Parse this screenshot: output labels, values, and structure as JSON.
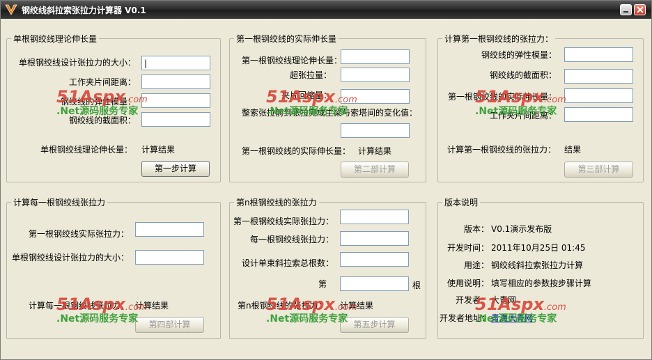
{
  "window": {
    "title": "钢绞线斜拉索张拉力计算器 V0.1"
  },
  "watermark": {
    "brand": "51Aspx",
    "domain": ".com",
    "slogan": ".Net源码服务专家"
  },
  "panel1": {
    "legend": "单根钢绞线理论伸长量",
    "labels": [
      "单根钢绞线设计张拉力的大小：",
      "工作夹片间距离：",
      "钢绞线的弹性模量：",
      "钢绞线的截面积："
    ],
    "input0_value": "|",
    "result_label": "单根钢绞线理论伸长量：",
    "result_value": "计算结果",
    "button": "第一步计算"
  },
  "panel2": {
    "legend": "第一根钢绞线的实际伸长量",
    "labels": [
      "第一根钢绞线理论伸长量：",
      "超张拉量：",
      "夹片回缩量：",
      "整索张拉前到张拉完成主梁与索塔间的变化值："
    ],
    "result_label": "第一根钢绞线的实际伸长量：",
    "result_value": "计算结果",
    "button": "第二部计算"
  },
  "panel3": {
    "legend": "计算第一根钢绞线的张拉力：",
    "labels": [
      "钢绞线的弹性模量：",
      "钢绞线的截面积：",
      "第一根钢绞线的实际伸长量：",
      "工作夹片间距离："
    ],
    "result_label": "计算第一根钢绞线的张拉力：",
    "result_value": "结果",
    "button": "第三部计算"
  },
  "panel4": {
    "legend": "计算每一根钢绞线张拉力",
    "labels": [
      "第一根钢绞线实际张拉力：",
      "单根钢绞线设计张拉力的大小："
    ],
    "result_label": "计算每一根钢绞线张拉力：",
    "result_value": "计算结果",
    "button": "第四部计算"
  },
  "panel5": {
    "legend": "第n根钢绞线的张拉力",
    "labels": [
      "第一根钢绞线实际张拉力：",
      "每一根钢绞线张拉力：",
      "设计单束斜拉索总根数：",
      "第"
    ],
    "unit": "根",
    "result_label": "第n根钢绞线的张拉力：",
    "result_value": "计算结果",
    "button": "第五步计算"
  },
  "panel6": {
    "legend": "版本说明",
    "rows": [
      {
        "label": "版本：",
        "value": "V0.1演示发布版"
      },
      {
        "label": "开发时间：",
        "value": "2011年10月25日 01:45"
      },
      {
        "label": "用途：",
        "value": "钢绞线斜拉索张拉力计算"
      },
      {
        "label": "使用说明：",
        "value": "填写相应的参数按步骤计算"
      },
      {
        "label": "开发者：",
        "value": "大青网"
      },
      {
        "label": "开发者地址：",
        "value": "青海大青网"
      }
    ]
  },
  "icons": {
    "app": "app-logo-icon",
    "minimize": "minimize-icon",
    "close": "close-icon"
  },
  "colors": {
    "titlebar": "#2c2c2c",
    "watermark_red": "#d9453a",
    "watermark_green": "#2e9a2e",
    "link": "#0000cc"
  }
}
